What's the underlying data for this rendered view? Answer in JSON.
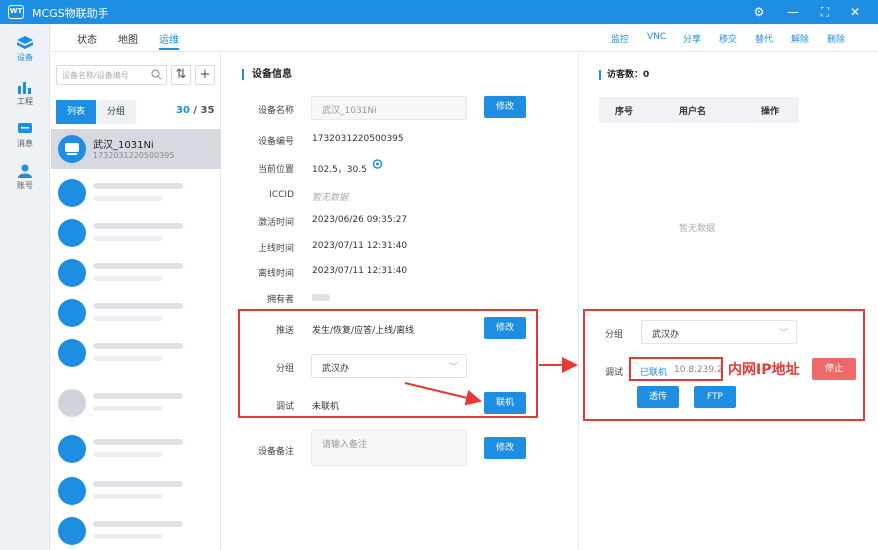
{
  "app": {
    "title": "MCGS物联助手",
    "logo_text": "WT"
  },
  "window_controls": {
    "settings": "⚙",
    "minimize": "—",
    "maximize": "⛶",
    "close": "✕"
  },
  "rail": [
    {
      "label": "设备",
      "active": true
    },
    {
      "label": "工程"
    },
    {
      "label": "消息"
    },
    {
      "label": "账号"
    }
  ],
  "tabs": [
    "状态",
    "地图",
    "运维"
  ],
  "active_tab": "运维",
  "top_links": [
    "监控",
    "VNC",
    "分享",
    "移交",
    "替代",
    "解除",
    "删除"
  ],
  "device_list": {
    "search_placeholder": "设备名称/设备编号",
    "sort_icon": "⇅",
    "add_icon": "+",
    "segments": [
      "列表",
      "分组"
    ],
    "count_current": "30",
    "count_sep": "/",
    "count_total": "35",
    "selected": {
      "name": "武汉_1031Ni",
      "id": "1732031220500395"
    }
  },
  "device_info": {
    "section_title": "设备信息",
    "labels": {
      "name": "设备名称",
      "serial": "设备编号",
      "location": "当前位置",
      "iccid": "ICCID",
      "activated": "激活时间",
      "online": "上线时间",
      "offline": "离线时间",
      "owner": "拥有者",
      "push": "推送",
      "group": "分组",
      "debug": "调试",
      "remark": "设备备注"
    },
    "values": {
      "name": "武汉_1031Ni",
      "serial": "1732031220500395",
      "location": "102.5，30.5",
      "iccid": "暂无数据",
      "activated": "2023/06/26 09:35:27",
      "online": "2023/07/11 12:31:40",
      "offline": "2023/07/11 12:31:40",
      "push": "发生/恢复/应答/上线/离线",
      "group": "武汉办",
      "debug": "未联机",
      "remark_placeholder": "请输入备注"
    },
    "buttons": {
      "edit": "修改",
      "connect": "联机"
    }
  },
  "visitors": {
    "title": "访客数：0",
    "columns": [
      "序号",
      "用户名",
      "操作"
    ],
    "empty": "暂无数据",
    "popup": {
      "group_label": "分组",
      "group_value": "武汉办",
      "debug_label": "调试",
      "connected_text": "已联机",
      "ip": "10.8.239.2",
      "stop_button": "停止",
      "passthrough_button": "透传",
      "ftp_button": "FTP"
    }
  },
  "annotation": {
    "text": "内网IP地址"
  },
  "colors": {
    "accent": "#1e8ee3",
    "annotation": "#e53935"
  }
}
